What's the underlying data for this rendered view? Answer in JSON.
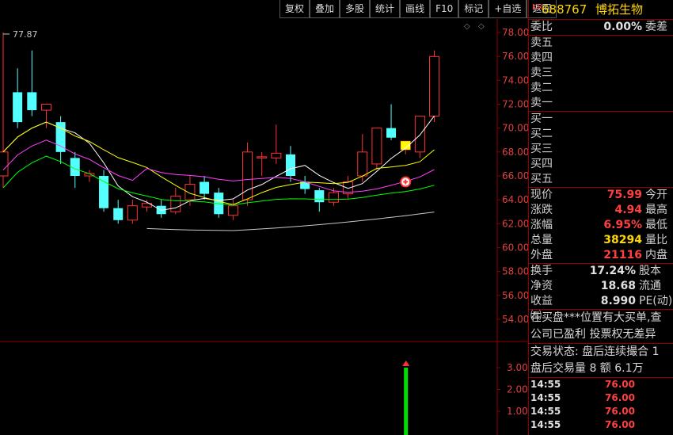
{
  "toolbar": {
    "buttons": [
      "复权",
      "叠加",
      "多股",
      "统计",
      "画线",
      "F10",
      "标记",
      "+自选",
      "返回"
    ]
  },
  "chart": {
    "price_axis": [
      "78.00",
      "76.00",
      "74.00",
      "72.00",
      "70.00",
      "68.00",
      "66.00",
      "64.00",
      "62.00",
      "60.00",
      "58.00",
      "56.00",
      "54.00"
    ],
    "volume_axis": [
      "3.00",
      "2.00",
      "1.00"
    ],
    "high_marker": "77.87",
    "candles": [
      {
        "o": 66,
        "h": 78,
        "l": 65,
        "c": 68
      },
      {
        "o": 73,
        "h": 75,
        "l": 70,
        "c": 70.5
      },
      {
        "o": 73,
        "h": 76.5,
        "l": 71,
        "c": 71.5
      },
      {
        "o": 71.5,
        "h": 72,
        "l": 70,
        "c": 72
      },
      {
        "o": 70.5,
        "h": 71,
        "l": 67,
        "c": 68
      },
      {
        "o": 67.5,
        "h": 68,
        "l": 65,
        "c": 66
      },
      {
        "o": 66,
        "h": 66.5,
        "l": 65.5,
        "c": 66.2
      },
      {
        "o": 66,
        "h": 66.5,
        "l": 63,
        "c": 63.3
      },
      {
        "o": 63.3,
        "h": 64,
        "l": 62,
        "c": 62.3
      },
      {
        "o": 62.3,
        "h": 64,
        "l": 62,
        "c": 63.5
      },
      {
        "o": 63.4,
        "h": 64,
        "l": 63,
        "c": 63.7
      },
      {
        "o": 63.5,
        "h": 64,
        "l": 62.5,
        "c": 62.8
      },
      {
        "o": 63,
        "h": 65,
        "l": 62.8,
        "c": 64.3
      },
      {
        "o": 64,
        "h": 66,
        "l": 63.5,
        "c": 65.3
      },
      {
        "o": 65.5,
        "h": 66,
        "l": 64,
        "c": 64.5
      },
      {
        "o": 64.6,
        "h": 65,
        "l": 62.5,
        "c": 62.8
      },
      {
        "o": 62.7,
        "h": 64,
        "l": 62.3,
        "c": 63.5
      },
      {
        "o": 64,
        "h": 68.8,
        "l": 63.5,
        "c": 68
      },
      {
        "o": 67.5,
        "h": 68,
        "l": 66,
        "c": 67.6
      },
      {
        "o": 67.5,
        "h": 70.3,
        "l": 67,
        "c": 67.9
      },
      {
        "o": 67.8,
        "h": 68.5,
        "l": 65.5,
        "c": 66
      },
      {
        "o": 65.5,
        "h": 66,
        "l": 64.5,
        "c": 64.9
      },
      {
        "o": 64.8,
        "h": 65,
        "l": 63,
        "c": 63.8
      },
      {
        "o": 63.8,
        "h": 65,
        "l": 63.5,
        "c": 64.6
      },
      {
        "o": 64.5,
        "h": 66,
        "l": 64,
        "c": 65.5
      },
      {
        "o": 66,
        "h": 69.5,
        "l": 65.5,
        "c": 68
      },
      {
        "o": 67,
        "h": 70,
        "l": 66.5,
        "c": 70
      },
      {
        "o": 70,
        "h": 72,
        "l": 69,
        "c": 69.2
      },
      {
        "o": 68.2,
        "h": 68.6,
        "l": 67.8,
        "c": 68.9
      },
      {
        "o": 68,
        "h": 71,
        "l": 67.5,
        "c": 71
      },
      {
        "o": 71,
        "h": 76.5,
        "l": 70.5,
        "c": 75.99
      }
    ],
    "ma_colors": {
      "ma5": "#ffffff",
      "ma10": "#ffff00",
      "ma20": "#ff40ff",
      "ma60": "#00ff00",
      "avg": "#c8c8c8"
    },
    "volume_value": 3.0
  },
  "panel": {
    "code": "688767",
    "name": "博拓生物",
    "kr": "KR",
    "weibi_label": "委比",
    "weibi_value": "0.00%",
    "weicha_label": "委差",
    "sell_labels": [
      "卖五",
      "卖四",
      "卖三",
      "卖二",
      "卖一"
    ],
    "buy_labels": [
      "买一",
      "买二",
      "买三",
      "买四",
      "买五"
    ],
    "quotes": [
      {
        "l1": "现价",
        "v1": "75.99",
        "c1": "red",
        "l2": "今开"
      },
      {
        "l1": "涨跌",
        "v1": "4.94",
        "c1": "red",
        "l2": "最高"
      },
      {
        "l1": "涨幅",
        "v1": "6.95%",
        "c1": "red",
        "l2": "最低"
      },
      {
        "l1": "总量",
        "v1": "38294",
        "c1": "yellow",
        "l2": "量比"
      },
      {
        "l1": "外盘",
        "v1": "21116",
        "c1": "red",
        "l2": "内盘"
      }
    ],
    "fund": [
      {
        "l1": "换手",
        "v1": "17.24%",
        "l2": "股本"
      },
      {
        "l1": "净资",
        "v1": "18.68",
        "l2": "流通"
      },
      {
        "l1": "收益㈢",
        "v1": "8.990",
        "l2": "PE(动)"
      }
    ],
    "notes": [
      "在买盘***位置有大买单,查",
      "公司已盈利 投票权无差异"
    ],
    "status": [
      "交易状态: 盘后连续撮合 1",
      "盘后交易量 8 额 6.1万"
    ],
    "trades": [
      {
        "time": "14:55",
        "price": "76.00"
      },
      {
        "time": "14:55",
        "price": "76.00"
      },
      {
        "time": "14:55",
        "price": "76.00"
      },
      {
        "time": "14:55",
        "price": "76.00"
      }
    ]
  }
}
